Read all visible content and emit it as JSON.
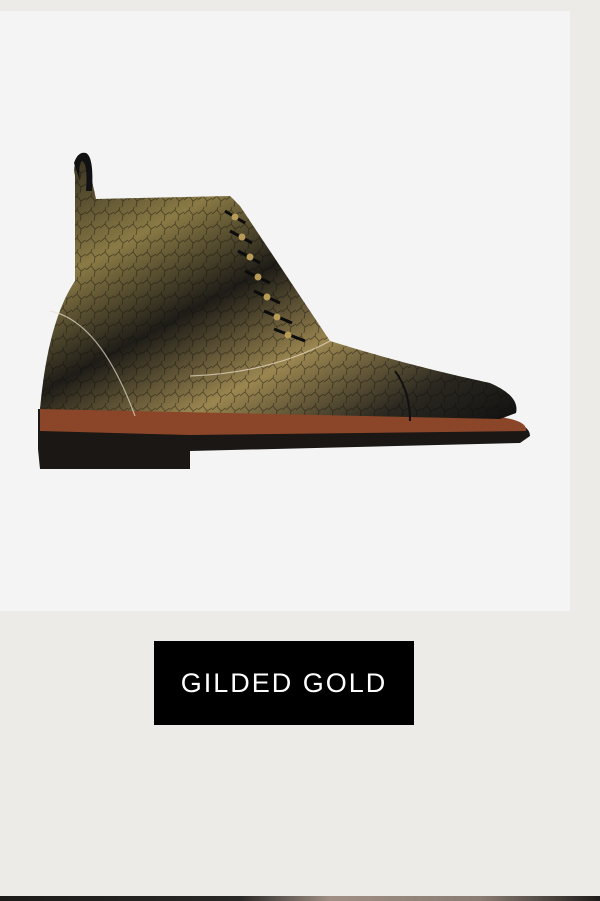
{
  "product": {
    "image_subject": "gilded-gold-cap-toe-boot",
    "variant_label": "GILDED GOLD"
  },
  "colors": {
    "page_background": "#ecebe8",
    "card_background": "#f4f4f4",
    "button_background": "#000000",
    "button_text": "#ffffff"
  }
}
